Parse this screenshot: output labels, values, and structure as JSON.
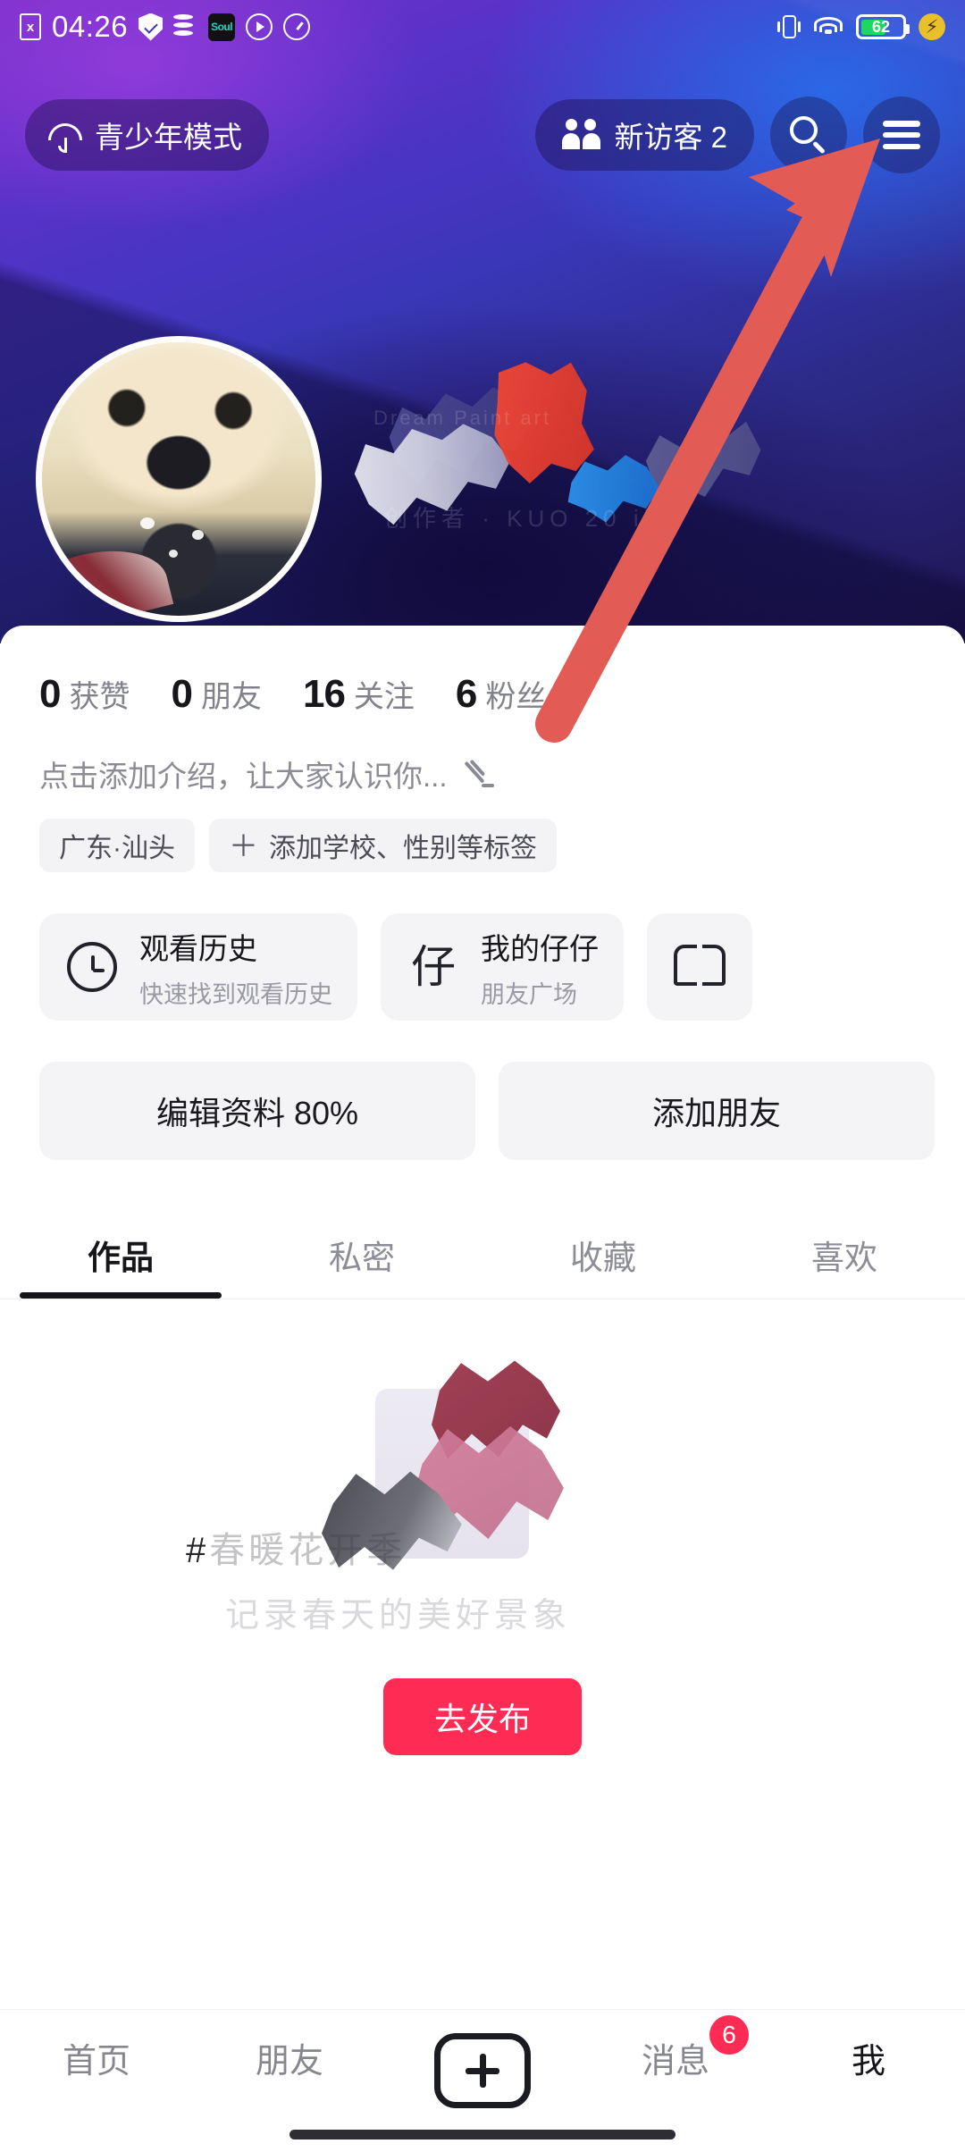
{
  "status_bar": {
    "time": "04:26",
    "left_icons": [
      "sim-card-off-icon",
      "shield-check-icon",
      "database-warning-icon",
      "soul-app-icon",
      "play-circle-icon",
      "speedometer-icon"
    ],
    "sim_glyph": "x",
    "soul_label": "Soul",
    "right_icons": [
      "vibrate-icon",
      "wifi-icon",
      "battery-icon",
      "fast-charge-icon"
    ],
    "battery_level": "62",
    "battery_percent": 62
  },
  "top_nav": {
    "teen_mode_label": "青少年模式",
    "teen_mode_icon": "umbrella-icon",
    "visitors_label": "新访客 2",
    "visitors_icon": "people-icon",
    "search_icon": "search-icon",
    "menu_icon": "hamburger-menu-icon"
  },
  "banner": {
    "watermark_line1": "Dream   Paint   art",
    "watermark_line2": "创作者 · KUO 20 ill"
  },
  "profile": {
    "avatar_alt": "golden-retriever-puppy-avatar",
    "stats": [
      {
        "num": "0",
        "label": "获赞"
      },
      {
        "num": "0",
        "label": "朋友"
      },
      {
        "num": "16",
        "label": "关注"
      },
      {
        "num": "6",
        "label": "粉丝"
      }
    ],
    "bio_placeholder": "点击添加介绍，让大家认识你...",
    "bio_edit_icon": "pencil-icon",
    "tags": [
      {
        "text": "广东·汕头",
        "has_plus": false
      },
      {
        "text": "添加学校、性别等标签",
        "has_plus": true
      }
    ]
  },
  "quick_cards": [
    {
      "icon": "history-clock-icon",
      "title": "观看历史",
      "subtitle": "快速找到观看历史"
    },
    {
      "icon": "zai-glyph-icon",
      "glyph": "仔",
      "title": "我的仔仔",
      "subtitle": "朋友广场"
    },
    {
      "icon": "book-icon",
      "title": "",
      "subtitle": ""
    }
  ],
  "actions": {
    "edit_profile": "编辑资料 80%",
    "add_friend": "添加朋友"
  },
  "tabs": [
    {
      "label": "作品",
      "active": true
    },
    {
      "label": "私密",
      "active": false
    },
    {
      "label": "收藏",
      "active": false
    },
    {
      "label": "喜欢",
      "active": false
    }
  ],
  "promo": {
    "hashtag_mark": "#",
    "hashtag_text": "春暖花开季",
    "subtitle": "记录春天的美好景象",
    "publish_button": "去发布"
  },
  "bottom_nav": [
    {
      "label": "首页",
      "type": "text",
      "active": false,
      "badge": ""
    },
    {
      "label": "朋友",
      "type": "text",
      "active": false,
      "badge": ""
    },
    {
      "label": "",
      "type": "plus",
      "active": false,
      "badge": "",
      "icon": "plus-create-icon"
    },
    {
      "label": "消息",
      "type": "text",
      "active": false,
      "badge": "6"
    },
    {
      "label": "我",
      "type": "text",
      "active": true,
      "badge": ""
    }
  ],
  "annotation": {
    "arrow_icon": "red-pointer-arrow",
    "color": "#e25b55",
    "points_to": "hamburger-menu-icon"
  },
  "colors": {
    "accent_red": "#fe2c55",
    "annotation_red": "#e25b55",
    "banner_purple": "#7c2fc8",
    "banner_blue": "#2b6ae0",
    "text_primary": "#16161a",
    "text_muted": "#86868f",
    "card_bg": "#f4f4f6",
    "battery_green": "#1ed760"
  }
}
